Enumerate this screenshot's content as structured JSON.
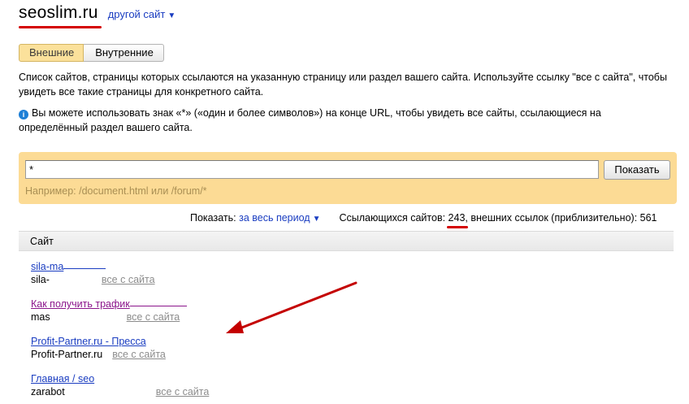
{
  "header": {
    "site_name": "seoslim.ru",
    "other_site_label": "другой сайт",
    "chevron_icon": "chevron-down-icon"
  },
  "tabs": [
    {
      "label": "Внешние",
      "active": true
    },
    {
      "label": "Внутренние",
      "active": false
    }
  ],
  "description": "Список сайтов, страницы которых ссылаются на указанную страницу или раздел вашего сайта. Используйте ссылку \"все с сайта\", чтобы увидеть все такие страницы для конкретного сайта.",
  "hint": {
    "icon": "info-icon",
    "text": "Вы можете использовать знак «*» («один и более символов») на конце URL, чтобы увидеть все сайты, ссылающиеся на определённый раздел вашего сайта."
  },
  "search": {
    "value": "*",
    "button_label": "Показать",
    "example": "Например: /document.html или /forum/*"
  },
  "summary": {
    "show_label": "Показать:",
    "period_label": "за весь период",
    "linking_sites_label": "Ссылающихся сайтов:",
    "linking_sites_count": "243",
    "external_links_label": ", внешних ссылок (приблизительно):",
    "external_links_count": "561"
  },
  "table": {
    "column_header": "Сайт",
    "rows": [
      {
        "title": "sila-ma",
        "domain": "sila-",
        "all_label": "все с сайта"
      },
      {
        "title": "Как получить трафик",
        "domain": "mas",
        "all_label": "все с сайта"
      },
      {
        "title": "Profit-Partner.ru - Пресса",
        "domain": "Profit-Partner.ru",
        "all_label": "все с сайта"
      },
      {
        "title": "Главная / seo",
        "domain": "zarabot",
        "all_label": "все с сайта"
      }
    ]
  },
  "colors": {
    "link": "#1a3dc1",
    "visited_link": "#8b158b",
    "panel": "#fcdb95",
    "annotation_red": "#d40000"
  }
}
